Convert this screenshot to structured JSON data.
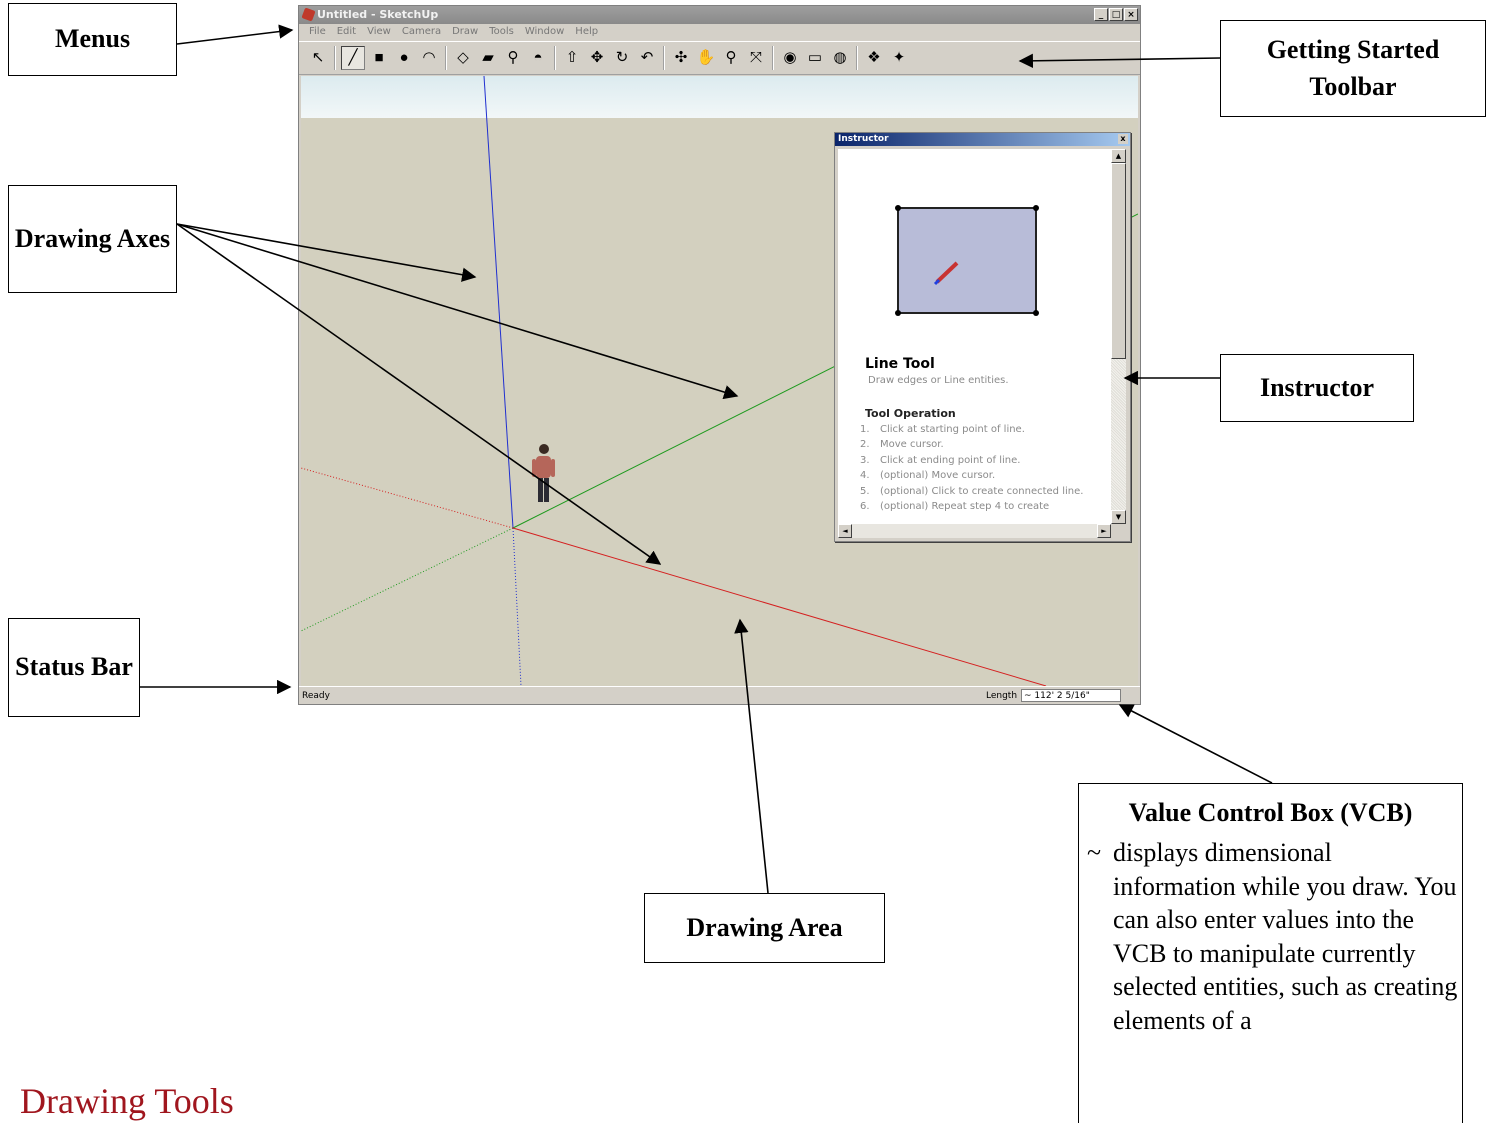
{
  "window": {
    "title": "Untitled - SketchUp",
    "controls": [
      "_",
      "□",
      "×"
    ]
  },
  "menus": [
    "File",
    "Edit",
    "View",
    "Camera",
    "Draw",
    "Tools",
    "Window",
    "Help"
  ],
  "toolbar": {
    "name": "Getting Started Toolbar",
    "tools": [
      {
        "name": "select-tool-icon",
        "glyph": "↖"
      },
      {
        "name": "line-tool-icon",
        "glyph": "╱",
        "selected": true
      },
      {
        "name": "rectangle-tool-icon",
        "glyph": "■"
      },
      {
        "name": "circle-tool-icon",
        "glyph": "●"
      },
      {
        "name": "arc-tool-icon",
        "glyph": "◠"
      },
      {
        "name": "make-component-icon",
        "glyph": "◇"
      },
      {
        "name": "eraser-icon",
        "glyph": "▰"
      },
      {
        "name": "tape-measure-icon",
        "glyph": "⚲"
      },
      {
        "name": "paint-bucket-icon",
        "glyph": "◓"
      },
      {
        "name": "push-pull-icon",
        "glyph": "⇧"
      },
      {
        "name": "move-icon",
        "glyph": "✥"
      },
      {
        "name": "rotate-icon",
        "glyph": "↻"
      },
      {
        "name": "offset-icon",
        "glyph": "↶"
      },
      {
        "name": "orbit-icon",
        "glyph": "✣"
      },
      {
        "name": "pan-icon",
        "glyph": "✋"
      },
      {
        "name": "zoom-icon",
        "glyph": "⚲"
      },
      {
        "name": "zoom-extents-icon",
        "glyph": "⤧"
      },
      {
        "name": "3d-warehouse-icon",
        "glyph": "◉"
      },
      {
        "name": "share-model-icon",
        "glyph": "▭"
      },
      {
        "name": "get-models-icon",
        "glyph": "◍"
      },
      {
        "name": "components-icon",
        "glyph": "❖"
      },
      {
        "name": "styles-icon",
        "glyph": "✦"
      }
    ]
  },
  "status": {
    "text": "Ready",
    "vcb_label": "Length",
    "vcb_value": "~ 112' 2 5/16\""
  },
  "instructor": {
    "title": "Instructor",
    "close": "x",
    "heading": "Line Tool",
    "subtitle": "Draw edges or Line entities.",
    "section": "Tool Operation",
    "steps": [
      {
        "n": "1.",
        "text": "Click at starting point of line."
      },
      {
        "n": "2.",
        "text": "Move cursor."
      },
      {
        "n": "3.",
        "text": "Click at ending point of line."
      },
      {
        "n": "4.",
        "text": "(optional) Move cursor."
      },
      {
        "n": "5.",
        "text": "(optional) Click to create connected line."
      },
      {
        "n": "6.",
        "text": "(optional) Repeat step 4 to create"
      }
    ]
  },
  "callouts": {
    "menus": "Menus",
    "toolbar": "Getting Started Toolbar",
    "axes": "Drawing Axes",
    "instructor": "Instructor",
    "status_bar": "Status Bar",
    "drawing_area": "Drawing Area",
    "vcb_title": "Value Control Box (VCB)",
    "vcb_tilde": "~",
    "vcb_text": "displays dimensional information while you draw. You can also enter values into the VCB to manipulate currently selected entities, such as creating elements of a"
  },
  "page_heading": "Drawing Tools",
  "colors": {
    "x_axis": "#d42020",
    "y_axis": "#1e9a1e",
    "z_axis": "#2030d0",
    "ground": "#d3d0bf",
    "sky": "#dcebef",
    "heading": "#a0161e"
  }
}
